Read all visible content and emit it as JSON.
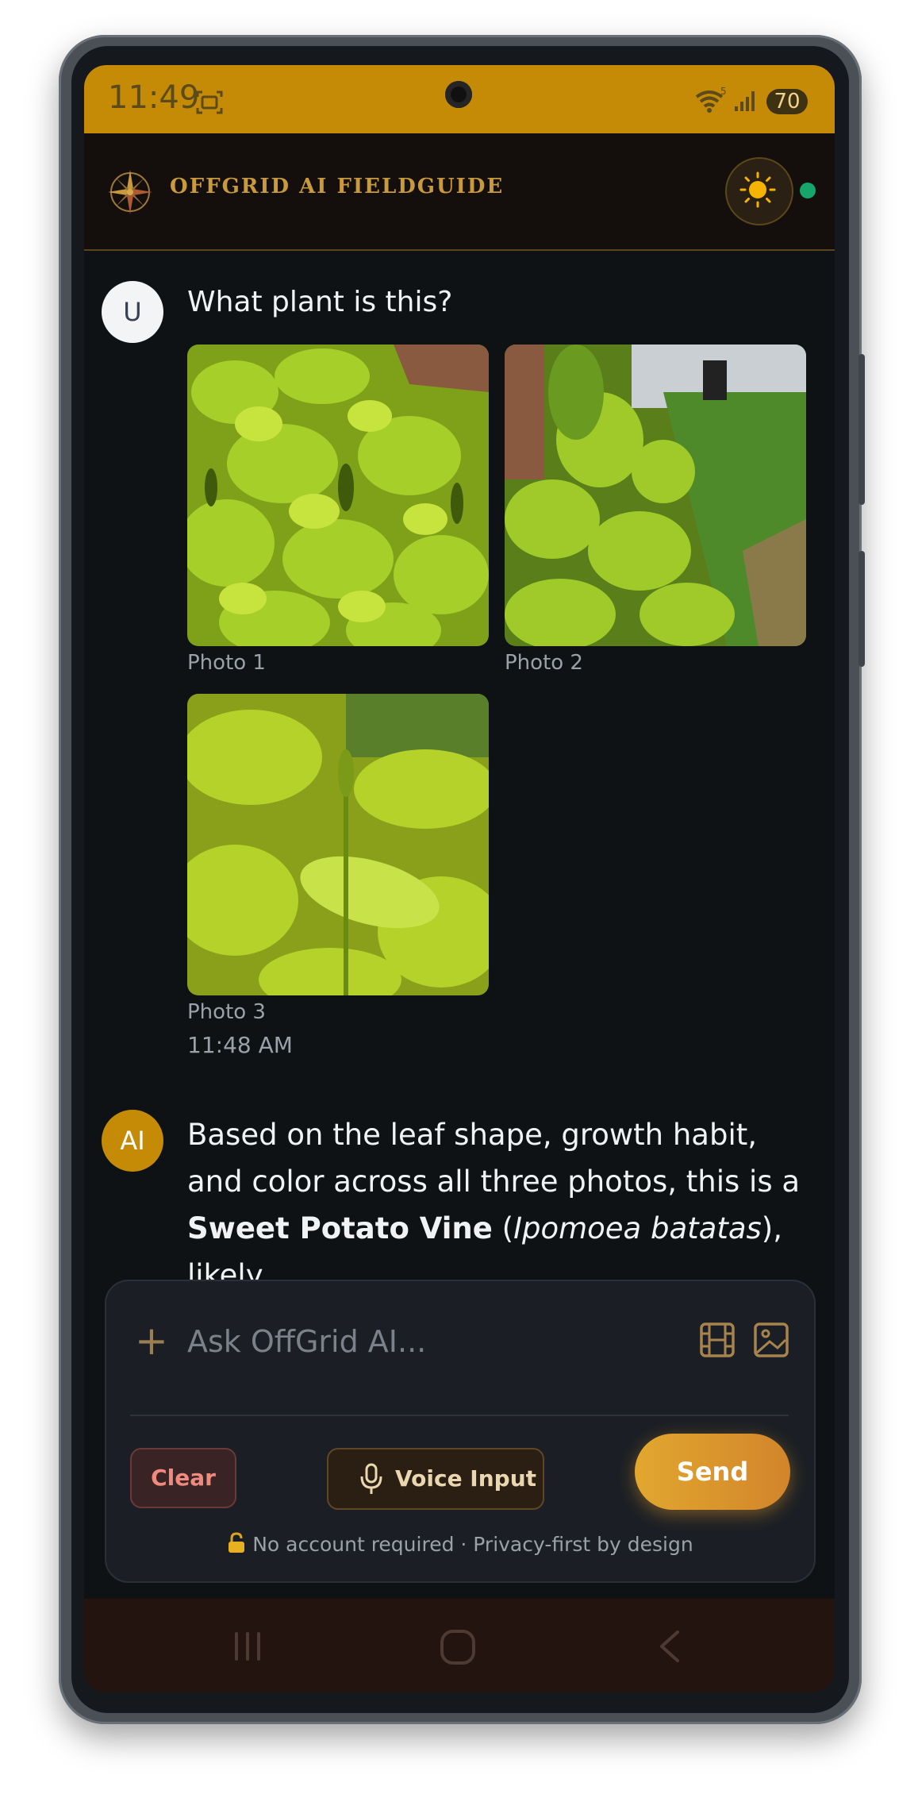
{
  "status_bar": {
    "time": "11:49",
    "network_badge": "5",
    "battery": "70",
    "icons": [
      "screenshot-icon",
      "wifi-icon",
      "signal-icon",
      "battery-icon"
    ]
  },
  "header": {
    "title": "OFFGRID AI FIELDGUIDE",
    "logo_icon": "compass-icon",
    "theme_icon": "sun-icon",
    "online_color": "#16a66a"
  },
  "messages": {
    "user": {
      "avatar": "U",
      "text": "What plant is this?",
      "photos": [
        {
          "label": "Photo 1"
        },
        {
          "label": "Photo 2"
        },
        {
          "label": "Photo 3"
        }
      ],
      "time": "11:48 AM"
    },
    "ai": {
      "avatar": "AI",
      "text_before": "Based on the leaf shape, growth habit, and color across all three photos, this is a ",
      "bold": "Sweet Potato Vine",
      "paren_open": " (",
      "italic": "Ipomoea batatas",
      "text_after": "), likely"
    }
  },
  "composer": {
    "placeholder": "Ask OffGrid AI...",
    "add_icon": "plus-icon",
    "clear_label": "Clear",
    "voice_label": "Voice Input",
    "send_label": "Send",
    "privacy_icon": "lock-icon",
    "privacy_text": "No account required · Privacy-first by design"
  },
  "nav": {
    "icons": [
      "recent-apps-icon",
      "home-icon",
      "back-icon"
    ]
  },
  "colors": {
    "accent": "#c58a06",
    "send_gradient": [
      "#e2a72e",
      "#d2852c"
    ],
    "background": "#0f1215"
  }
}
